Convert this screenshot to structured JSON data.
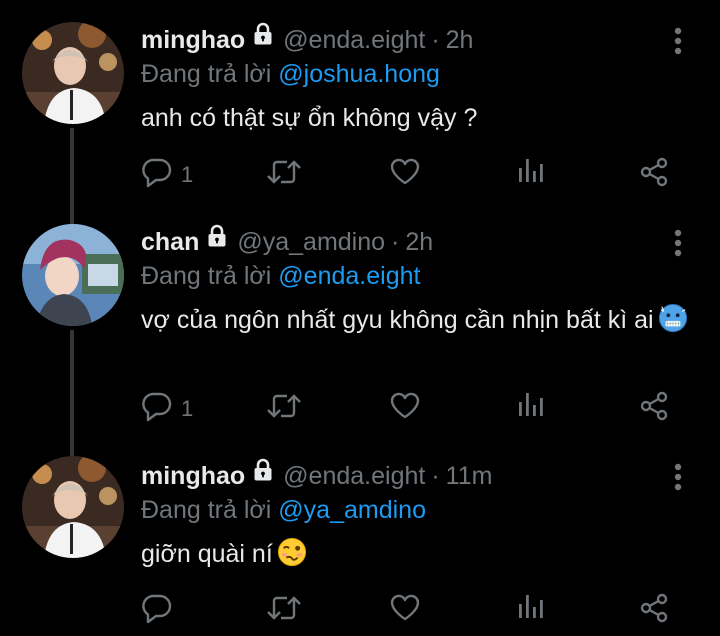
{
  "reply_prefix": "Đang trả lời",
  "colors": {
    "background": "#000000",
    "text": "#e7e9ea",
    "secondary": "#71767b",
    "link": "#1d9bf0",
    "thread_line": "#333639"
  },
  "tweets": [
    {
      "name": "minghao",
      "handle": "@enda.eight",
      "dot": "·",
      "time": "2h",
      "replying_to": "@joshua.hong",
      "text": "anh có thật sự ổn không vậy ?",
      "emoji": "",
      "reply_count": "1",
      "avatar": "person-avatar-warm-lights",
      "icons": [
        "lock-icon",
        "more-vertical-icon",
        "reply-icon",
        "retweet-icon",
        "like-icon",
        "analytics-icon",
        "share-icon"
      ]
    },
    {
      "name": "chan",
      "handle": "@ya_amdino",
      "dot": "·",
      "time": "2h",
      "replying_to": "@enda.eight",
      "text": "vợ của ngôn nhất gyu không cần nhịn bất kì ai",
      "emoji": "cold-face-emoji",
      "reply_count": "1",
      "avatar": "person-avatar-purple-hair",
      "icons": [
        "lock-icon",
        "more-vertical-icon",
        "reply-icon",
        "retweet-icon",
        "like-icon",
        "analytics-icon",
        "share-icon"
      ]
    },
    {
      "name": "minghao",
      "handle": "@enda.eight",
      "dot": "·",
      "time": "11m",
      "replying_to": "@ya_amdino",
      "text": "giỡn quài ní",
      "emoji": "woozy-face-emoji",
      "reply_count": "",
      "avatar": "person-avatar-warm-lights",
      "icons": [
        "lock-icon",
        "more-vertical-icon",
        "reply-icon",
        "retweet-icon",
        "like-icon",
        "analytics-icon",
        "share-icon"
      ]
    }
  ]
}
